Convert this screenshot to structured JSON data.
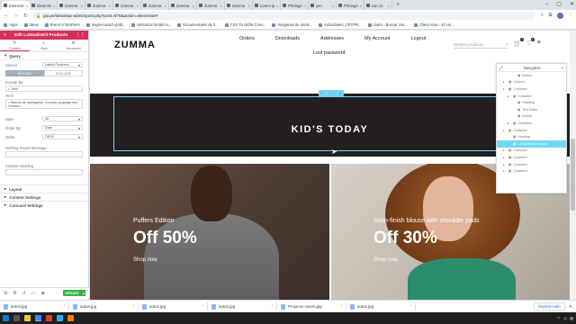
{
  "browser": {
    "tabs": [
      {
        "label": "Elemento",
        "active": true
      },
      {
        "label": "Ideas Dis"
      },
      {
        "label": "Zumma"
      },
      {
        "label": "Zumma"
      },
      {
        "label": "Zumma"
      },
      {
        "label": "Zumma"
      },
      {
        "label": "Zumma"
      },
      {
        "label": "Zumma"
      },
      {
        "label": "Zumma"
      },
      {
        "label": "Lorem ip"
      },
      {
        "label": "Photogra"
      },
      {
        "label": "yen"
      },
      {
        "label": "Photogra"
      },
      {
        "label": "can 12"
      }
    ],
    "url": "gio.pe/ideas/wp-admin/post.php?post=670&action=elementor#",
    "bookmarks": [
      "Apps",
      "Ideas",
      "Brand of Brothers",
      "maps-munich-polit...",
      "Historical trends in...",
      "Documentales de h...",
      "CSV To ISON Conv...",
      "Imágenes de stock...",
      "Actividades_CETPR...",
      "zoom - Buscar con...",
      "Client Area - 42 Ho..."
    ]
  },
  "panel": {
    "title": "Edit LaStudioKit Products",
    "tabs": [
      "Content",
      "Style",
      "Advanced"
    ],
    "query_section": "Query",
    "source_label": "Source",
    "source_value": "Latest Products",
    "include_label": "INCLUDE",
    "exclude_label": "EXCLUDE",
    "include_by_label": "Include By",
    "include_by_value": "× Term",
    "term_label": "Term",
    "term_value": "× Marcos de navegación, Zumma Language and Commu...",
    "date_label": "Date",
    "date_value": "All",
    "order_by_label": "Order By",
    "order_by_value": "Date",
    "order_label": "Order",
    "order_value": "DESC",
    "nothing_found_label": "Nothing Found Message",
    "custom_heading_label": "Custom Heading",
    "sections": [
      "Layout",
      "Content Settings",
      "Carousel Settings"
    ],
    "update_label": "UPDATE"
  },
  "site": {
    "logo": "ZUMMA",
    "menu": [
      "Orders",
      "Downloads",
      "Addresses",
      "My Account",
      "Logout"
    ],
    "lost_password": "Lost password",
    "search_placeholder": "Search products...",
    "cart_count": "0",
    "wishlist_count": "0",
    "section_title": "KID'S TODAY",
    "banners": [
      {
        "subtitle": "Puffers Edition",
        "headline": "Off 50%",
        "link": "Shop now"
      },
      {
        "subtitle": "Satin-finish blouse with shoulder pads",
        "headline": "Off 30%",
        "link": "Shop now"
      }
    ]
  },
  "navigator": {
    "title": "Navigator",
    "items": [
      {
        "label": "Button",
        "level": 3
      },
      {
        "label": "Column",
        "level": 1
      },
      {
        "label": "Container",
        "level": 1
      },
      {
        "label": "Container",
        "level": 2
      },
      {
        "label": "Heading",
        "level": 3
      },
      {
        "label": "Text Editor",
        "level": 3
      },
      {
        "label": "Button",
        "level": 3
      },
      {
        "label": "Container",
        "level": 2
      },
      {
        "label": "Container",
        "level": 1
      },
      {
        "label": "Heading",
        "level": 2
      },
      {
        "label": "LaStudioKit Products",
        "level": 2,
        "highlight": true
      },
      {
        "label": "Container",
        "level": 1
      },
      {
        "label": "Container",
        "level": 1
      },
      {
        "label": "Container",
        "level": 1
      },
      {
        "label": "Container",
        "level": 1
      }
    ]
  },
  "downloads": {
    "files": [
      "auto3.jpg",
      "auto4.jpg",
      "auto1.jpg",
      "auto2.jpg",
      "Proyecto nuevo.jpg",
      "auto1.jpg"
    ],
    "show_all": "Mostrar todo"
  },
  "colors": {
    "elementor_accent": "#d5305c",
    "selection_blue": "#71d7f7",
    "update_green": "#39b54a",
    "dark_band": "#231f20"
  }
}
